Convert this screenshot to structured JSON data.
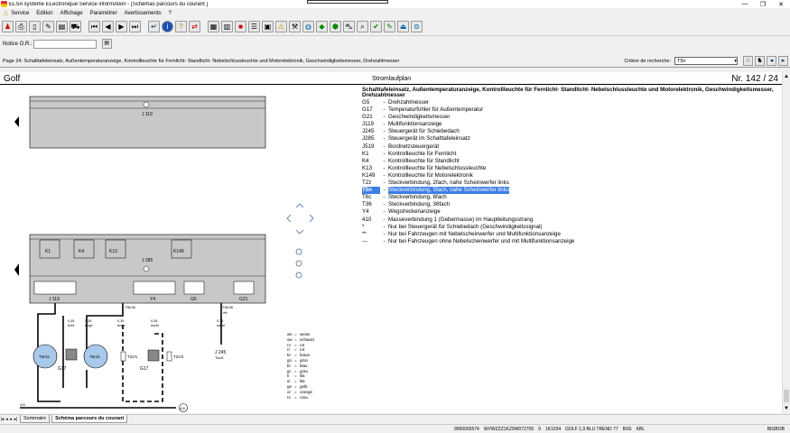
{
  "window": {
    "title": "ELSA système ELectronique Service informAtion - [Schémas parcours du courant ]",
    "controls": [
      "—",
      "❐",
      "✕"
    ]
  },
  "menu": {
    "items": [
      "Service",
      "Edition",
      "Affichage",
      "Paramètrer",
      "Avertissements",
      "?"
    ]
  },
  "notice": {
    "label": "Notice O.R.:",
    "value": ""
  },
  "pagebar": {
    "breadcrumb": "Page 24: Schalttafeleinsatz, Außentemperaturanzeige, Kontrollleuchte für Fernlicht- Standlicht- Nebelschlussleuchte und Motorelektronik, Geschwindigkeitsmesser, Drehzahlmesser",
    "criteria_label": "Critère de recherche:",
    "criteria_value": "T5n"
  },
  "doc": {
    "model": "Golf",
    "schema_type": "Stromlaufplan",
    "page_number": "Nr.  142 / 24",
    "legend_title": "Schalttafeleinsatz, Außentemperaturanzeige, Kontrollleuchte für Fernlicht- Standlicht- Nebelschlussleuchte und Motorelektronik, Geschwindigkeitsmesser, Drehzahlmesser",
    "legend": [
      {
        "code": "G5",
        "desc": "Drehzahlmesser"
      },
      {
        "code": "G17",
        "desc": "Temperaturfühler für Außentemperatur"
      },
      {
        "code": "G21",
        "desc": "Geschwindigkeitsmesser"
      },
      {
        "code": "J119",
        "desc": "Multifunktionsanzeige"
      },
      {
        "code": "J245",
        "desc": "Steuergerät für Schiebedach"
      },
      {
        "code": "J285",
        "desc": "Steuergerät im Schalttafeleinsatz"
      },
      {
        "code": "J519",
        "desc": "Bordnetzsteuergerät"
      },
      {
        "code": "K1",
        "desc": "Kontrollleuchte für Fernlicht"
      },
      {
        "code": "K4",
        "desc": "Kontrollleuchte für Standlicht"
      },
      {
        "code": "K13",
        "desc": "Kontrollleuchte für Nebelschlussleuchte"
      },
      {
        "code": "K149",
        "desc": "Kontrollleuchte für Motorelektronik"
      },
      {
        "code": "T2z",
        "desc": "Steckverbindung, 2fach, nahe Scheinwerfer links"
      },
      {
        "code": "T5n",
        "desc": "Steckverbindung, 5fach, nahe Scheinwerfer links"
      },
      {
        "code": "T6c",
        "desc": "Steckverbindung, 6fach"
      },
      {
        "code": "T36",
        "desc": "Steckverbindung, 36fach"
      },
      {
        "code": "Y4",
        "desc": "Wegstreckenanzeige"
      },
      {
        "code": "410",
        "desc": "Masseverbindung 1 (Gebermasse) im Hauptleitungsstrang"
      },
      {
        "code": "*",
        "desc": "Nur bei Steuergerät für Schiebedach (Geschwindigkeitssignal)"
      },
      {
        "code": "**",
        "desc": "Nur bei Fahrzeugen mit Nebelscheinwerfer und Multifunktionsanzeige"
      },
      {
        "code": "---",
        "desc": "Nur bei Fahrzeugen ohne Nebelscheinwerfer und mit Multifunktionsanzeige"
      }
    ],
    "wire_colors": [
      {
        "code": "ws",
        "name": "weiss"
      },
      {
        "code": "sw",
        "name": "schwarz"
      },
      {
        "code": "ro",
        "name": "rot"
      },
      {
        "code": "rt",
        "name": "rot"
      },
      {
        "code": "br",
        "name": "braun"
      },
      {
        "code": "gn",
        "name": "grün"
      },
      {
        "code": "bl",
        "name": "blau"
      },
      {
        "code": "gr",
        "name": "grau"
      },
      {
        "code": "li",
        "name": "lila"
      },
      {
        "code": "vi",
        "name": "lila"
      },
      {
        "code": "ge",
        "name": "gelb"
      },
      {
        "code": "or",
        "name": "orange"
      },
      {
        "code": "rs",
        "name": "rosa"
      }
    ],
    "diagram": {
      "j119": "J 119",
      "j285": "J 285",
      "k1": "K1",
      "k4": "K4",
      "k13": "K13",
      "k149": "K149",
      "y4": "Y4",
      "g5": "G5",
      "g21": "G21",
      "g17": "G17",
      "t5n": "T5n/3",
      "t5n_b": "T5n/4",
      "t2z": "T2z/1",
      "t2z_b": "T2z/2",
      "t36": "T36/36",
      "t6c": "T36/36",
      "j245": "J 245",
      "j245_sub": "Tbc/6",
      "ground": "410",
      "wire1": "0,35",
      "wire1_c": "br/bl",
      "wire2_c": "br/ge",
      "wire3_c": "ws/bl",
      "stars": "**"
    }
  },
  "tabs": [
    "Sommaire",
    "Schéma parcours du courant"
  ],
  "status": {
    "doc_id": "9000000574",
    "vin": "WVWZZZ1KZ9W072705",
    "year": "9",
    "code": "1K1034",
    "model": "GOLF 1,9 BLU TREND 77",
    "engine": "BXE",
    "gear": "KBL",
    "right": "BIGBOB"
  },
  "colors": {
    "accent": "#3d7ee6",
    "module_fill": "#c8c8c8",
    "bulb_fill": "#a9c9ea"
  }
}
